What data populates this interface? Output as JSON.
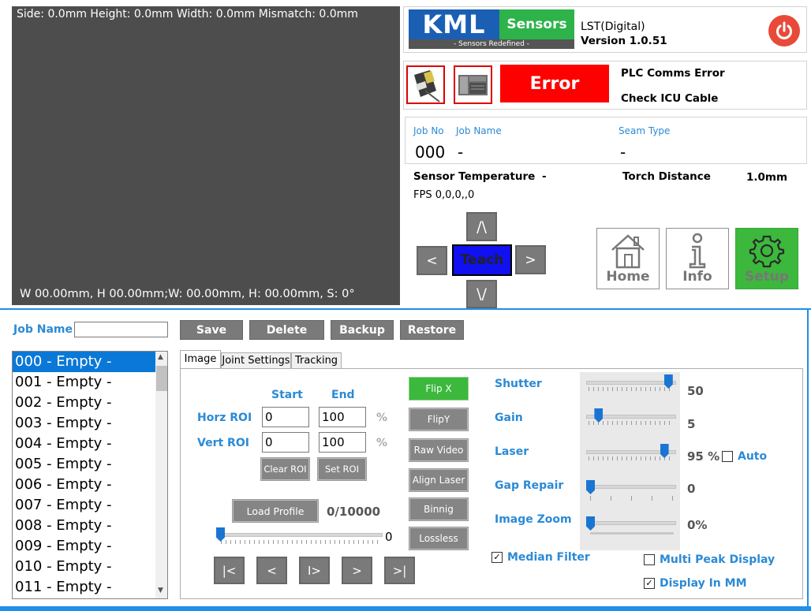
{
  "video": {
    "top_text": "Side: 0.0mm Height: 0.0mm Width: 0.0mm Mismatch: 0.0mm",
    "bottom_text": "W 00.00mm,  H 00.00mm;W: 00.00mm, H: 00.00mm, S: 0°"
  },
  "header": {
    "logo_kml": "KML",
    "logo_sensors": "Sensors",
    "logo_tagline": "- Sensors Redefined -",
    "product": "LST(Digital)",
    "version": "Version 1.0.51",
    "power_icon": "power-icon"
  },
  "status": {
    "error_label": "Error",
    "message1": "PLC Comms Error",
    "message2": "Check ICU Cable",
    "error_color": "#ff0000"
  },
  "job": {
    "job_no_label": "Job No",
    "job_name_label": "Job Name",
    "seam_type_label": "Seam Type",
    "job_no": "000",
    "job_name": "-",
    "seam_type": "-",
    "sensor_temp_label": "Sensor Temperature",
    "sensor_temp": "-",
    "torch_distance_label": "Torch Distance",
    "torch_distance": "1.0mm",
    "fps": "FPS 0,0,0,,0"
  },
  "teach": {
    "up": "/\\",
    "left": "<",
    "center": "Teach",
    "right": ">",
    "down": "\\/"
  },
  "tiles": {
    "home": "Home",
    "info": "Info",
    "setup": "Setup",
    "setup_color": "#3cb83c"
  },
  "jobbar": {
    "job_name_label": "Job Name",
    "job_name_value": "",
    "save": "Save",
    "delete": "Delete",
    "backup": "Backup",
    "restore": "Restore"
  },
  "joblist": [
    "000 - Empty -",
    "001 - Empty -",
    "002 - Empty -",
    "003 - Empty -",
    "004 - Empty -",
    "005 - Empty -",
    "006 - Empty -",
    "007 - Empty -",
    "008 - Empty -",
    "009 - Empty -",
    "010 - Empty -",
    "011 - Empty -"
  ],
  "tabs": [
    "Image",
    "Joint Settings",
    "Tracking"
  ],
  "roi": {
    "start_label": "Start",
    "end_label": "End",
    "horz_label": "Horz ROI",
    "vert_label": "Vert ROI",
    "horz_start": "0",
    "horz_end": "100",
    "vert_start": "0",
    "vert_end": "100",
    "pct": "%",
    "clear": "Clear ROI",
    "set": "Set ROI"
  },
  "profile": {
    "load": "Load Profile",
    "count": "0/10000",
    "slider_value": "0",
    "nav_first": "|<",
    "nav_prev": "<",
    "nav_play": "I>",
    "nav_next": ">",
    "nav_last": ">|"
  },
  "image_buttons": {
    "flipx": "Flip X",
    "flipy": "FlipY",
    "raw": "Raw Video",
    "align": "Align Laser",
    "binning": "Binnig",
    "lossless": "Lossless"
  },
  "sliders": {
    "shutter_label": "Shutter",
    "shutter_value": "50",
    "shutter_level": 0.95,
    "gain_label": "Gain",
    "gain_value": "5",
    "gain_level": 0.1,
    "laser_label": "Laser",
    "laser_value": "95 %",
    "laser_level": 0.9,
    "gap_label": "Gap Repair",
    "gap_value": "0",
    "gap_level": 0,
    "zoom_label": "Image Zoom",
    "zoom_value": "0%",
    "zoom_level": 0
  },
  "checks": {
    "auto": "Auto",
    "auto_checked": false,
    "median": "Median Filter",
    "median_checked": true,
    "multipeak": "Multi Peak Display",
    "multipeak_checked": false,
    "mm": "Display In MM",
    "mm_checked": true
  }
}
